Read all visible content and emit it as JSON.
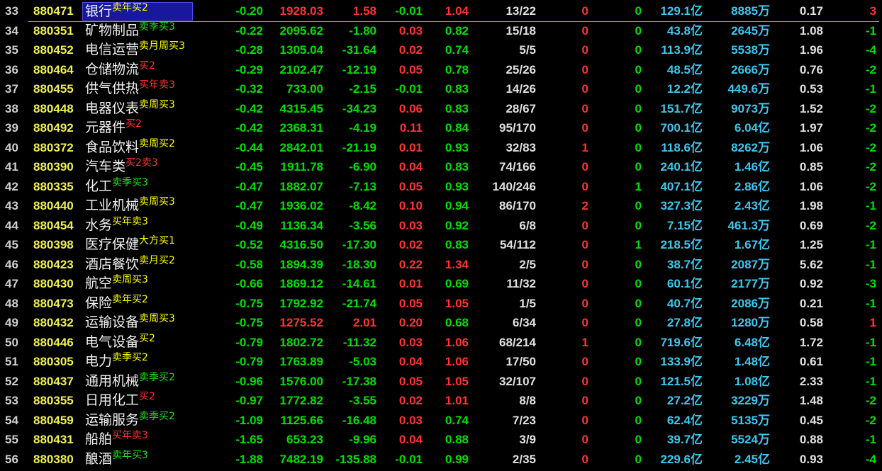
{
  "colors": {
    "background": "#000000",
    "up": "#ff3232",
    "down": "#00e000",
    "neutral": "#e0e0e0",
    "row_number": "#d0d0d0",
    "code": "#f0f050",
    "name": "#f2f2f2",
    "amount": "#3cc8f0",
    "selection_bg": "#18189c",
    "cursor_line": "#b8b800"
  },
  "rows": [
    {
      "no": "33",
      "code": "880471",
      "name": "银行",
      "tag": "卖年买2",
      "tag_color": "#ffff00",
      "pct": "-0.20",
      "price": "1928.03",
      "chg": "1.58",
      "speed": "-0.01",
      "ratio": "1.04",
      "updown": "13/22",
      "n_up": "0",
      "n_down": "0",
      "amount": "129.1亿",
      "volume": "8885万",
      "value": "0.17",
      "last": "3",
      "selected": true
    },
    {
      "no": "34",
      "code": "880351",
      "name": "矿物制品",
      "tag": "卖季买3",
      "tag_color": "#22dd22",
      "pct": "-0.22",
      "price": "2095.62",
      "chg": "-1.80",
      "speed": "0.03",
      "ratio": "0.82",
      "updown": "15/18",
      "n_up": "0",
      "n_down": "0",
      "amount": "43.8亿",
      "volume": "2645万",
      "value": "1.08",
      "last": "-1"
    },
    {
      "no": "35",
      "code": "880452",
      "name": "电信运营",
      "tag": "卖月周买3",
      "tag_color": "#ffff00",
      "pct": "-0.28",
      "price": "1305.04",
      "chg": "-31.64",
      "speed": "0.02",
      "ratio": "0.74",
      "updown": "5/5",
      "n_up": "0",
      "n_down": "0",
      "amount": "113.9亿",
      "volume": "5538万",
      "value": "1.96",
      "last": "-4"
    },
    {
      "no": "36",
      "code": "880464",
      "name": "仓储物流",
      "tag": "买2",
      "tag_color": "#ff3030",
      "pct": "-0.29",
      "price": "2102.47",
      "chg": "-12.19",
      "speed": "0.05",
      "ratio": "0.78",
      "updown": "25/26",
      "n_up": "0",
      "n_down": "0",
      "amount": "48.5亿",
      "volume": "2666万",
      "value": "0.76",
      "last": "-2"
    },
    {
      "no": "37",
      "code": "880455",
      "name": "供气供热",
      "tag": "买年卖3",
      "tag_color": "#ff3030",
      "pct": "-0.32",
      "price": "733.00",
      "chg": "-2.15",
      "speed": "-0.01",
      "ratio": "0.83",
      "updown": "14/26",
      "n_up": "0",
      "n_down": "0",
      "amount": "12.2亿",
      "volume": "449.6万",
      "value": "0.53",
      "last": "-1"
    },
    {
      "no": "38",
      "code": "880448",
      "name": "电器仪表",
      "tag": "卖周买3",
      "tag_color": "#ffff00",
      "pct": "-0.42",
      "price": "4315.45",
      "chg": "-34.23",
      "speed": "0.06",
      "ratio": "0.83",
      "updown": "28/67",
      "n_up": "0",
      "n_down": "0",
      "amount": "151.7亿",
      "volume": "9073万",
      "value": "1.52",
      "last": "-2"
    },
    {
      "no": "39",
      "code": "880492",
      "name": "元器件",
      "tag": "买2",
      "tag_color": "#ff3030",
      "pct": "-0.42",
      "price": "2368.31",
      "chg": "-4.19",
      "speed": "0.11",
      "ratio": "0.84",
      "updown": "95/170",
      "n_up": "0",
      "n_down": "0",
      "amount": "700.1亿",
      "volume": "6.04亿",
      "value": "1.97",
      "last": "-2"
    },
    {
      "no": "40",
      "code": "880372",
      "name": "食品饮料",
      "tag": "卖周买2",
      "tag_color": "#ffff00",
      "pct": "-0.44",
      "price": "2842.01",
      "chg": "-21.19",
      "speed": "0.01",
      "ratio": "0.93",
      "updown": "32/83",
      "n_up": "1",
      "n_down": "0",
      "amount": "118.6亿",
      "volume": "8262万",
      "value": "1.06",
      "last": "-2"
    },
    {
      "no": "41",
      "code": "880390",
      "name": "汽车类",
      "tag": "买2卖3",
      "tag_color": "#ff3030",
      "pct": "-0.45",
      "price": "1911.78",
      "chg": "-6.90",
      "speed": "0.04",
      "ratio": "0.83",
      "updown": "74/166",
      "n_up": "0",
      "n_down": "0",
      "amount": "240.1亿",
      "volume": "1.46亿",
      "value": "0.85",
      "last": "-2"
    },
    {
      "no": "42",
      "code": "880335",
      "name": "化工",
      "tag": "卖季买3",
      "tag_color": "#22dd22",
      "pct": "-0.47",
      "price": "1882.07",
      "chg": "-7.13",
      "speed": "0.05",
      "ratio": "0.93",
      "updown": "140/246",
      "n_up": "0",
      "n_down": "1",
      "amount": "407.1亿",
      "volume": "2.86亿",
      "value": "1.06",
      "last": "-2"
    },
    {
      "no": "43",
      "code": "880440",
      "name": "工业机械",
      "tag": "卖周买3",
      "tag_color": "#ffff00",
      "pct": "-0.47",
      "price": "1936.02",
      "chg": "-8.42",
      "speed": "0.10",
      "ratio": "0.94",
      "updown": "86/170",
      "n_up": "2",
      "n_down": "0",
      "amount": "327.3亿",
      "volume": "2.43亿",
      "value": "1.98",
      "last": "-1"
    },
    {
      "no": "44",
      "code": "880454",
      "name": "水务",
      "tag": "买年卖3",
      "tag_color": "#ffff00",
      "pct": "-0.49",
      "price": "1136.34",
      "chg": "-3.56",
      "speed": "0.03",
      "ratio": "0.92",
      "updown": "6/8",
      "n_up": "0",
      "n_down": "0",
      "amount": "7.15亿",
      "volume": "461.3万",
      "value": "0.69",
      "last": "-2"
    },
    {
      "no": "45",
      "code": "880398",
      "name": "医疗保健",
      "tag": "大方买1",
      "tag_color": "#ffff00",
      "pct": "-0.52",
      "price": "4316.50",
      "chg": "-17.30",
      "speed": "0.02",
      "ratio": "0.83",
      "updown": "54/112",
      "n_up": "0",
      "n_down": "1",
      "amount": "218.5亿",
      "volume": "1.67亿",
      "value": "1.25",
      "last": "-1"
    },
    {
      "no": "46",
      "code": "880423",
      "name": "酒店餐饮",
      "tag": "卖月买2",
      "tag_color": "#ffff00",
      "pct": "-0.58",
      "price": "1894.39",
      "chg": "-18.30",
      "speed": "0.22",
      "ratio": "1.34",
      "updown": "2/5",
      "n_up": "0",
      "n_down": "0",
      "amount": "38.7亿",
      "volume": "2087万",
      "value": "5.62",
      "last": "-1"
    },
    {
      "no": "47",
      "code": "880430",
      "name": "航空",
      "tag": "卖周买3",
      "tag_color": "#ffff00",
      "pct": "-0.66",
      "price": "1869.12",
      "chg": "-14.61",
      "speed": "0.01",
      "ratio": "0.69",
      "updown": "11/32",
      "n_up": "0",
      "n_down": "0",
      "amount": "60.1亿",
      "volume": "2177万",
      "value": "0.92",
      "last": "-3"
    },
    {
      "no": "48",
      "code": "880473",
      "name": "保险",
      "tag": "卖年买2",
      "tag_color": "#ffff00",
      "pct": "-0.75",
      "price": "1792.92",
      "chg": "-21.74",
      "speed": "0.05",
      "ratio": "1.05",
      "updown": "1/5",
      "n_up": "0",
      "n_down": "0",
      "amount": "40.7亿",
      "volume": "2086万",
      "value": "0.21",
      "last": "-1"
    },
    {
      "no": "49",
      "code": "880432",
      "name": "运输设备",
      "tag": "卖周买3",
      "tag_color": "#ffff00",
      "pct": "-0.75",
      "price": "1275.52",
      "chg": "2.01",
      "speed": "0.20",
      "ratio": "0.68",
      "updown": "6/34",
      "n_up": "0",
      "n_down": "0",
      "amount": "27.8亿",
      "volume": "1280万",
      "value": "0.58",
      "last": "1"
    },
    {
      "no": "50",
      "code": "880446",
      "name": "电气设备",
      "tag": "买2",
      "tag_color": "#ffff00",
      "pct": "-0.79",
      "price": "1802.72",
      "chg": "-11.32",
      "speed": "0.03",
      "ratio": "1.06",
      "updown": "68/214",
      "n_up": "1",
      "n_down": "0",
      "amount": "719.6亿",
      "volume": "6.48亿",
      "value": "1.72",
      "last": "-1"
    },
    {
      "no": "51",
      "code": "880305",
      "name": "电力",
      "tag": "卖季买2",
      "tag_color": "#ffff00",
      "pct": "-0.79",
      "price": "1763.89",
      "chg": "-5.03",
      "speed": "0.04",
      "ratio": "1.06",
      "updown": "17/50",
      "n_up": "0",
      "n_down": "0",
      "amount": "133.9亿",
      "volume": "1.48亿",
      "value": "0.61",
      "last": "-1"
    },
    {
      "no": "52",
      "code": "880437",
      "name": "通用机械",
      "tag": "卖季买2",
      "tag_color": "#22dd22",
      "pct": "-0.96",
      "price": "1576.00",
      "chg": "-17.38",
      "speed": "0.05",
      "ratio": "1.05",
      "updown": "32/107",
      "n_up": "0",
      "n_down": "0",
      "amount": "121.5亿",
      "volume": "1.08亿",
      "value": "2.33",
      "last": "-1"
    },
    {
      "no": "53",
      "code": "880355",
      "name": "日用化工",
      "tag": "买2",
      "tag_color": "#ff3030",
      "pct": "-0.97",
      "price": "1772.82",
      "chg": "-3.55",
      "speed": "0.02",
      "ratio": "1.01",
      "updown": "8/8",
      "n_up": "0",
      "n_down": "0",
      "amount": "27.2亿",
      "volume": "3229万",
      "value": "1.48",
      "last": "-2"
    },
    {
      "no": "54",
      "code": "880459",
      "name": "运输服务",
      "tag": "卖季买2",
      "tag_color": "#22dd22",
      "pct": "-1.09",
      "price": "1125.66",
      "chg": "-16.48",
      "speed": "0.03",
      "ratio": "0.74",
      "updown": "7/23",
      "n_up": "0",
      "n_down": "0",
      "amount": "62.4亿",
      "volume": "5135万",
      "value": "0.45",
      "last": "-2"
    },
    {
      "no": "55",
      "code": "880431",
      "name": "船舶",
      "tag": "买年卖3",
      "tag_color": "#ff3030",
      "pct": "-1.65",
      "price": "653.23",
      "chg": "-9.96",
      "speed": "0.04",
      "ratio": "0.88",
      "updown": "3/9",
      "n_up": "0",
      "n_down": "0",
      "amount": "39.7亿",
      "volume": "5524万",
      "value": "0.88",
      "last": "-1"
    },
    {
      "no": "56",
      "code": "880380",
      "name": "酿酒",
      "tag": "卖年买3",
      "tag_color": "#22dd22",
      "pct": "-1.88",
      "price": "7482.19",
      "chg": "-135.88",
      "speed": "-0.01",
      "ratio": "0.99",
      "updown": "2/35",
      "n_up": "0",
      "n_down": "0",
      "amount": "229.6亿",
      "volume": "2.45亿",
      "value": "0.93",
      "last": "-4"
    }
  ]
}
